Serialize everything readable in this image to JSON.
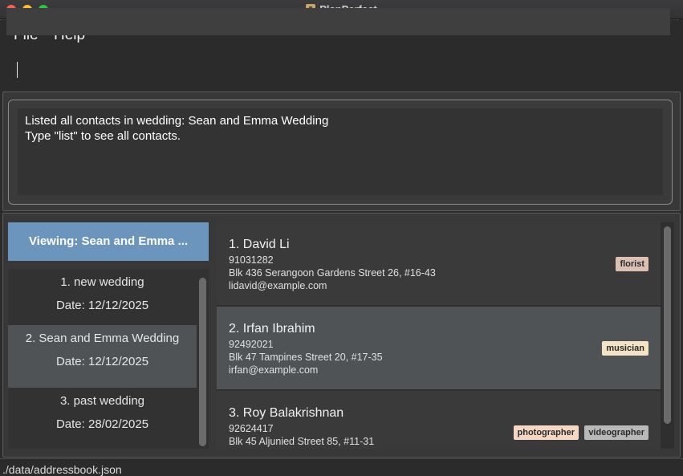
{
  "window": {
    "title": "PlanPerfect"
  },
  "menu": {
    "file": "File",
    "help": "Help"
  },
  "command": {
    "value": "",
    "placeholder": ""
  },
  "result": {
    "line1": "Listed all contacts in wedding: Sean and Emma Wedding",
    "line2": "Type \"list\" to see all contacts."
  },
  "viewing_label": "Viewing: Sean and Emma ...",
  "weddings": [
    {
      "name": "1. new wedding",
      "date": "Date: 12/12/2025",
      "selected": false
    },
    {
      "name": "2. Sean and Emma Wedding",
      "date": "Date: 12/12/2025",
      "selected": true
    },
    {
      "name": "3. past wedding",
      "date": "Date: 28/02/2025",
      "selected": false
    }
  ],
  "persons": [
    {
      "name": "1. David Li",
      "phone": "91031282",
      "address": "Blk 436 Serangoon Gardens Street 26, #16-43",
      "email": "lidavid@example.com",
      "tags": [
        "florist"
      ],
      "selected": false
    },
    {
      "name": "2. Irfan Ibrahim",
      "phone": "92492021",
      "address": "Blk 47 Tampines Street 20, #17-35",
      "email": "irfan@example.com",
      "tags": [
        "musician"
      ],
      "selected": true
    },
    {
      "name": "3. Roy Balakrishnan",
      "phone": "92624417",
      "address": "Blk 45 Aljunied Street 85, #11-31",
      "email": "",
      "tags": [
        "photographer",
        "videographer"
      ],
      "selected": false
    }
  ],
  "tag_colors": {
    "florist": "#dcc0b4",
    "musician": "#f2e3c4",
    "photographer": "#f5d7c3",
    "videographer": "#b8b8b8"
  },
  "colors": {
    "viewing_bg": "#6b95bd",
    "selected_row": "#4f5356",
    "card_bg": "#3a3a3a"
  },
  "status": {
    "path": "./data/addressbook.json"
  }
}
